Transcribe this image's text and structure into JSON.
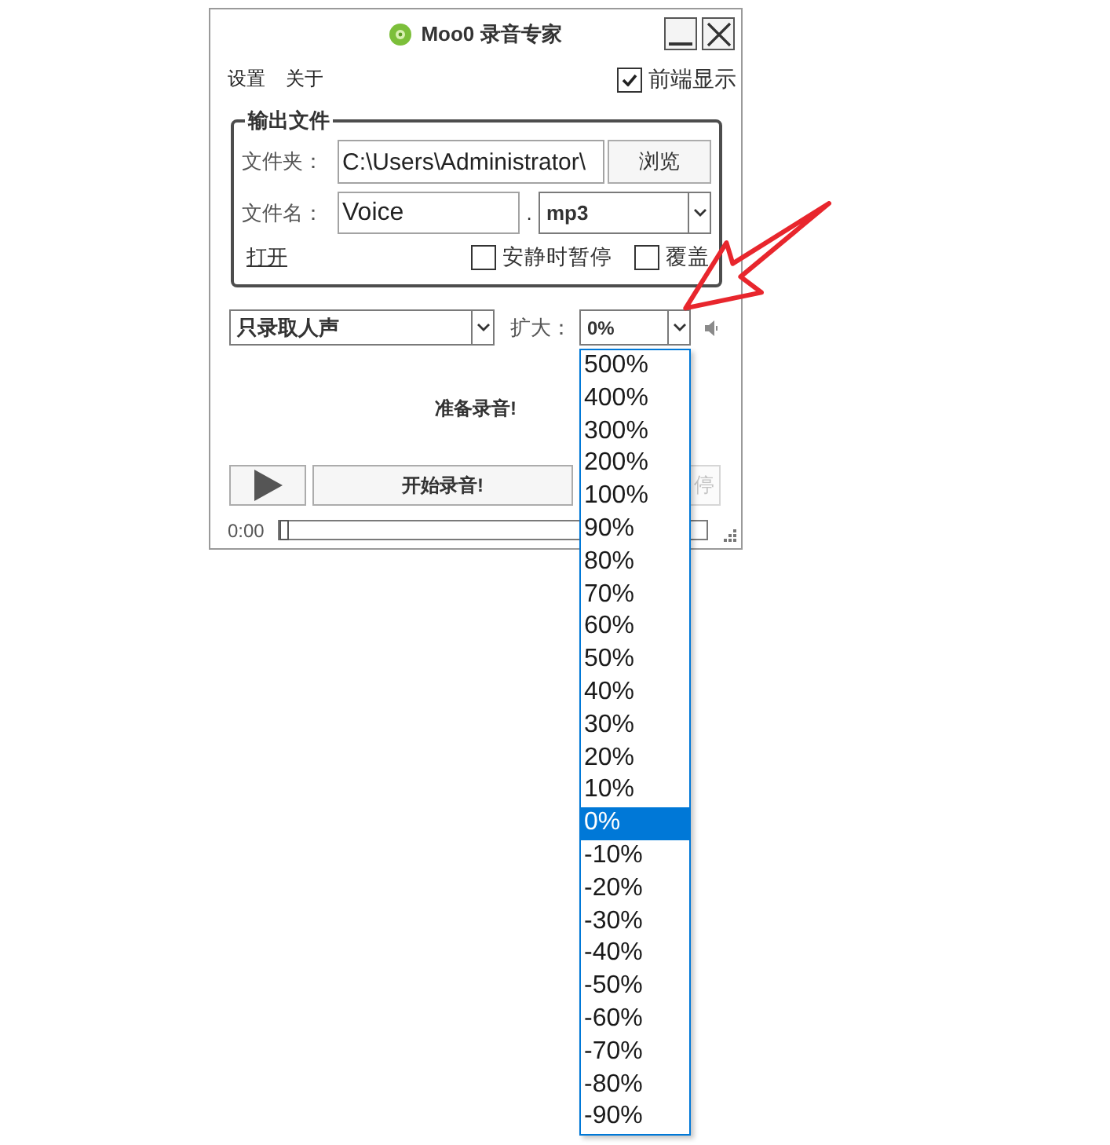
{
  "window": {
    "title": "Moo0 录音专家"
  },
  "menu": [
    "设置",
    "关于"
  ],
  "always_on_top": {
    "label": "前端显示",
    "checked": true
  },
  "output_file": {
    "title": "输出文件",
    "folder": {
      "label": "文件夹：",
      "value": "C:\\Users\\Administrator\\",
      "button": "浏览"
    },
    "file_name": {
      "label": "文件名：",
      "value": "Voice",
      "separator": ".",
      "format": "mp3"
    },
    "open_link": "打开",
    "options": [
      {
        "label": "安静时暂停",
        "checked": false
      },
      {
        "label": "覆盖",
        "checked": false
      }
    ]
  },
  "mode_select": {
    "value": "只录取人声"
  },
  "amplify": {
    "label": "扩大：",
    "value": "0%",
    "expanded": true,
    "options": [
      {
        "label": "500%",
        "selected": false
      },
      {
        "label": "400%",
        "selected": false
      },
      {
        "label": "300%",
        "selected": false
      },
      {
        "label": "200%",
        "selected": false
      },
      {
        "label": "100%",
        "selected": false
      },
      {
        "label": "90%",
        "selected": false
      },
      {
        "label": "80%",
        "selected": false
      },
      {
        "label": "70%",
        "selected": false
      },
      {
        "label": "60%",
        "selected": false
      },
      {
        "label": "50%",
        "selected": false
      },
      {
        "label": "40%",
        "selected": false
      },
      {
        "label": "30%",
        "selected": false
      },
      {
        "label": "20%",
        "selected": false
      },
      {
        "label": "10%",
        "selected": false
      },
      {
        "label": "0%",
        "selected": true
      },
      {
        "label": "-10%",
        "selected": false
      },
      {
        "label": "-20%",
        "selected": false
      },
      {
        "label": "-30%",
        "selected": false
      },
      {
        "label": "-40%",
        "selected": false
      },
      {
        "label": "-50%",
        "selected": false
      },
      {
        "label": "-60%",
        "selected": false
      },
      {
        "label": "-70%",
        "selected": false
      },
      {
        "label": "-80%",
        "selected": false
      },
      {
        "label": "-90%",
        "selected": false
      }
    ]
  },
  "status": "准备录音!",
  "buttons": {
    "record": "开始录音!",
    "pause": {
      "label": "停",
      "disabled": true
    }
  },
  "progress": {
    "time": "0:00",
    "level": 0
  }
}
